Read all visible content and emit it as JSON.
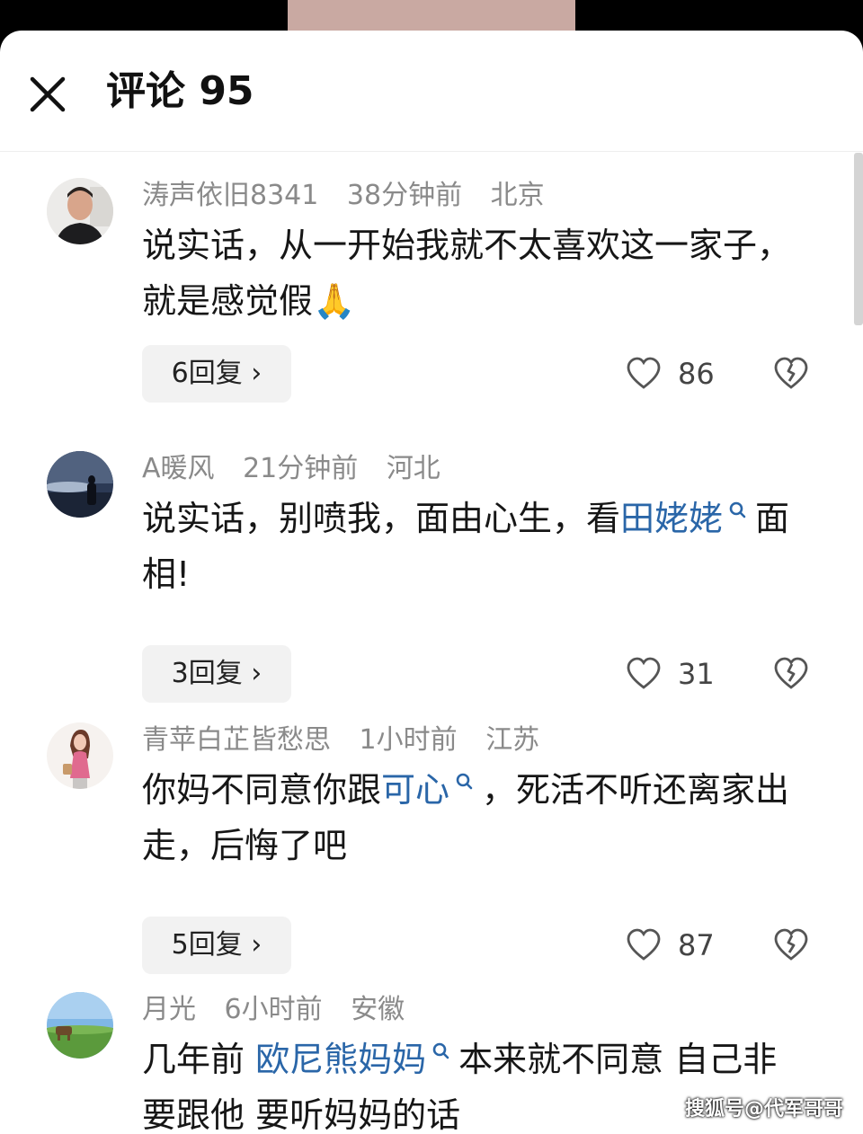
{
  "header": {
    "title": "评论 95"
  },
  "comments": [
    {
      "user": "涛声依旧8341",
      "time": "38分钟前",
      "location": "北京",
      "text_before": "说实话，从一开始我就不太喜欢这一家子，就是感觉假",
      "emoji": "🙏",
      "replies": "6回复",
      "likes": "86"
    },
    {
      "user": "A暖风",
      "time": "21分钟前",
      "location": "河北",
      "text_before": "说实话，别喷我，面由心生，看",
      "link": "田姥姥",
      "text_after": "面相!",
      "replies": "3回复",
      "likes": "31"
    },
    {
      "user": "青苹白芷皆愁思",
      "time": "1小时前",
      "location": "江苏",
      "text_before": "你妈不同意你跟",
      "link": "可心",
      "text_after": "，死活不听还离家出走，后悔了吧",
      "replies": "5回复",
      "likes": "87"
    },
    {
      "user": "月光",
      "time": "6小时前",
      "location": "安徽",
      "text_before": "几年前 ",
      "link": "欧尼熊妈妈",
      "text_after": "本来就不同意 自己非要跟他 要听妈妈的话"
    }
  ],
  "watermark": "搜狐号@代军哥哥",
  "colors": {
    "link": "#2a66a8",
    "meta": "#8a8a8a",
    "reply_bg": "#f2f2f2"
  },
  "icons": [
    "close-icon",
    "heart-icon",
    "broken-heart-icon",
    "search-icon"
  ]
}
